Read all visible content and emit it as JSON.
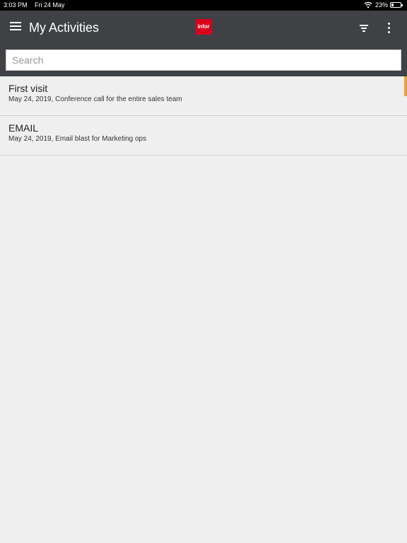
{
  "status_bar": {
    "time": "3:03 PM",
    "date": "Fri 24 May",
    "battery": "23%",
    "icons": [
      "wifi-icon",
      "battery-icon"
    ]
  },
  "header": {
    "title": "My Activities",
    "logo_text": "infor",
    "icons": [
      "menu-icon",
      "filter-icon",
      "more-vertical-icon"
    ],
    "colors": {
      "bar": "#404144",
      "logo": "#d9001b"
    }
  },
  "search": {
    "placeholder": "Search",
    "value": ""
  },
  "activities": [
    {
      "title": "First visit",
      "subtitle": "May 24, 2019, Conference call for the entire sales team"
    },
    {
      "title": "EMAIL",
      "subtitle": "May 24, 2019, Email blast for Marketing ops"
    }
  ],
  "colors": {
    "selected_indicator": "#e6a23c",
    "background": "#efefef"
  }
}
